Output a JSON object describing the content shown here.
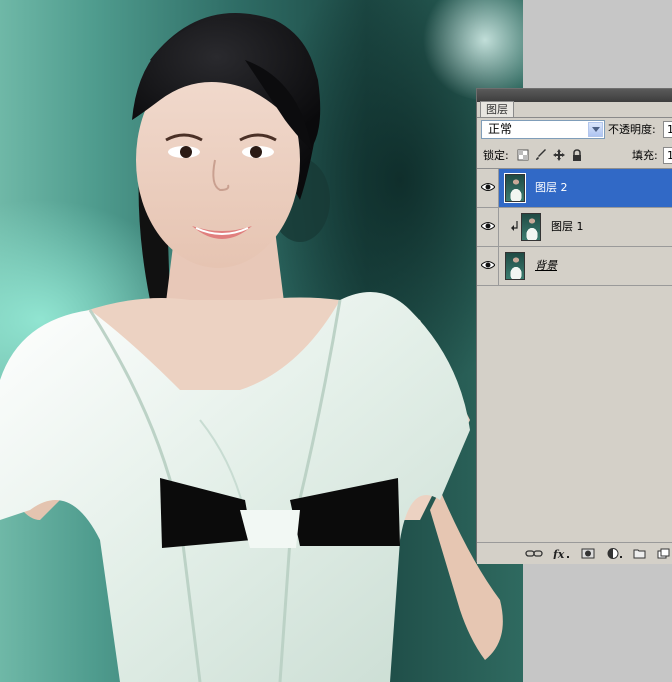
{
  "panel": {
    "tab_label": "图层",
    "blend_mode": "正常",
    "opacity_label": "不透明度:",
    "opacity_value": "1",
    "lock_label": "锁定:",
    "fill_label": "填充:",
    "fill_value": "1",
    "lock_icons": [
      "lock-transparent-icon",
      "lock-brush-icon",
      "lock-move-icon",
      "lock-all-icon"
    ],
    "bottom_icons": [
      "link-icon",
      "fx-icon",
      "mask-icon",
      "adjustment-icon",
      "group-folder-icon",
      "new-layer-icon"
    ]
  },
  "layers": [
    {
      "name": "图层 2",
      "selected": true,
      "visible": true,
      "clipped": false
    },
    {
      "name": "图层 1",
      "selected": false,
      "visible": true,
      "clipped": true
    },
    {
      "name": "背景",
      "selected": false,
      "visible": true,
      "clipped": false
    }
  ],
  "colors": {
    "selection": "#3169c6",
    "panel_bg": "#d4d0c8",
    "workspace": "#c6c6c6"
  }
}
